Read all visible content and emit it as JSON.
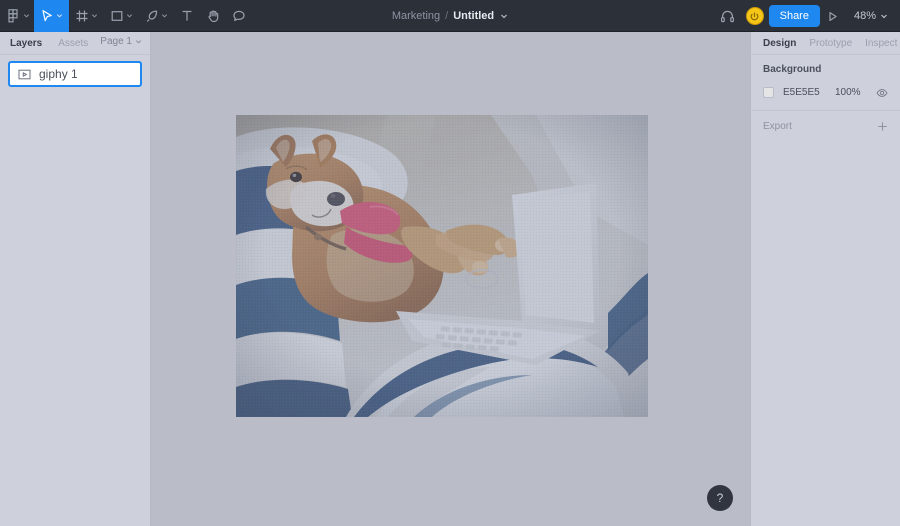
{
  "topbar": {
    "tools": [
      {
        "name": "figma-menu",
        "icon": "figma-logo-icon",
        "caret": true,
        "active": false
      },
      {
        "name": "move",
        "icon": "cursor-arrow-icon",
        "caret": true,
        "active": true
      },
      {
        "name": "frame",
        "icon": "frame-grid-icon",
        "caret": true,
        "active": false
      },
      {
        "name": "shape",
        "icon": "square-icon",
        "caret": true,
        "active": false
      },
      {
        "name": "pen",
        "icon": "pen-icon",
        "caret": true,
        "active": false
      },
      {
        "name": "text",
        "icon": "text-t-icon",
        "caret": false,
        "active": false
      },
      {
        "name": "hand",
        "icon": "hand-icon",
        "caret": false,
        "active": false
      },
      {
        "name": "comment",
        "icon": "comment-bubble-icon",
        "caret": false,
        "active": false
      }
    ],
    "project_name": "Marketing",
    "separator": "/",
    "file_name": "Untitled",
    "headphones_icon": "headphones-icon",
    "avatar_icon": "power-avatar-icon",
    "avatar_color": "#F5C518",
    "share_label": "Share",
    "present_icon": "play-triangle-icon",
    "zoom_level": "48%",
    "accent_color": "#1E88F0",
    "bar_color": "#2C3039"
  },
  "left_panel": {
    "tabs": [
      {
        "label": "Layers",
        "active": true
      },
      {
        "label": "Assets",
        "active": false
      }
    ],
    "page_selector": "Page 1",
    "layers": [
      {
        "name": "giphy 1",
        "icon": "video-frame-icon",
        "selected": true
      }
    ]
  },
  "canvas": {
    "background_color": "#BABDC8",
    "artboard": {
      "name": "giphy 1",
      "alt": "Shiba Inu dog lying on striped blue and white bedding typing on a white laptop"
    }
  },
  "right_panel": {
    "tabs": [
      {
        "label": "Design",
        "active": true
      },
      {
        "label": "Prototype",
        "active": false
      },
      {
        "label": "Inspect",
        "active": false
      }
    ],
    "background": {
      "title": "Background",
      "hex": "E5E5E5",
      "swatch_color": "#E5E5E5",
      "opacity": "100%",
      "visibility_icon": "eye-icon"
    },
    "export": {
      "label": "Export",
      "add_icon": "plus-icon"
    }
  },
  "help": {
    "label": "?"
  }
}
